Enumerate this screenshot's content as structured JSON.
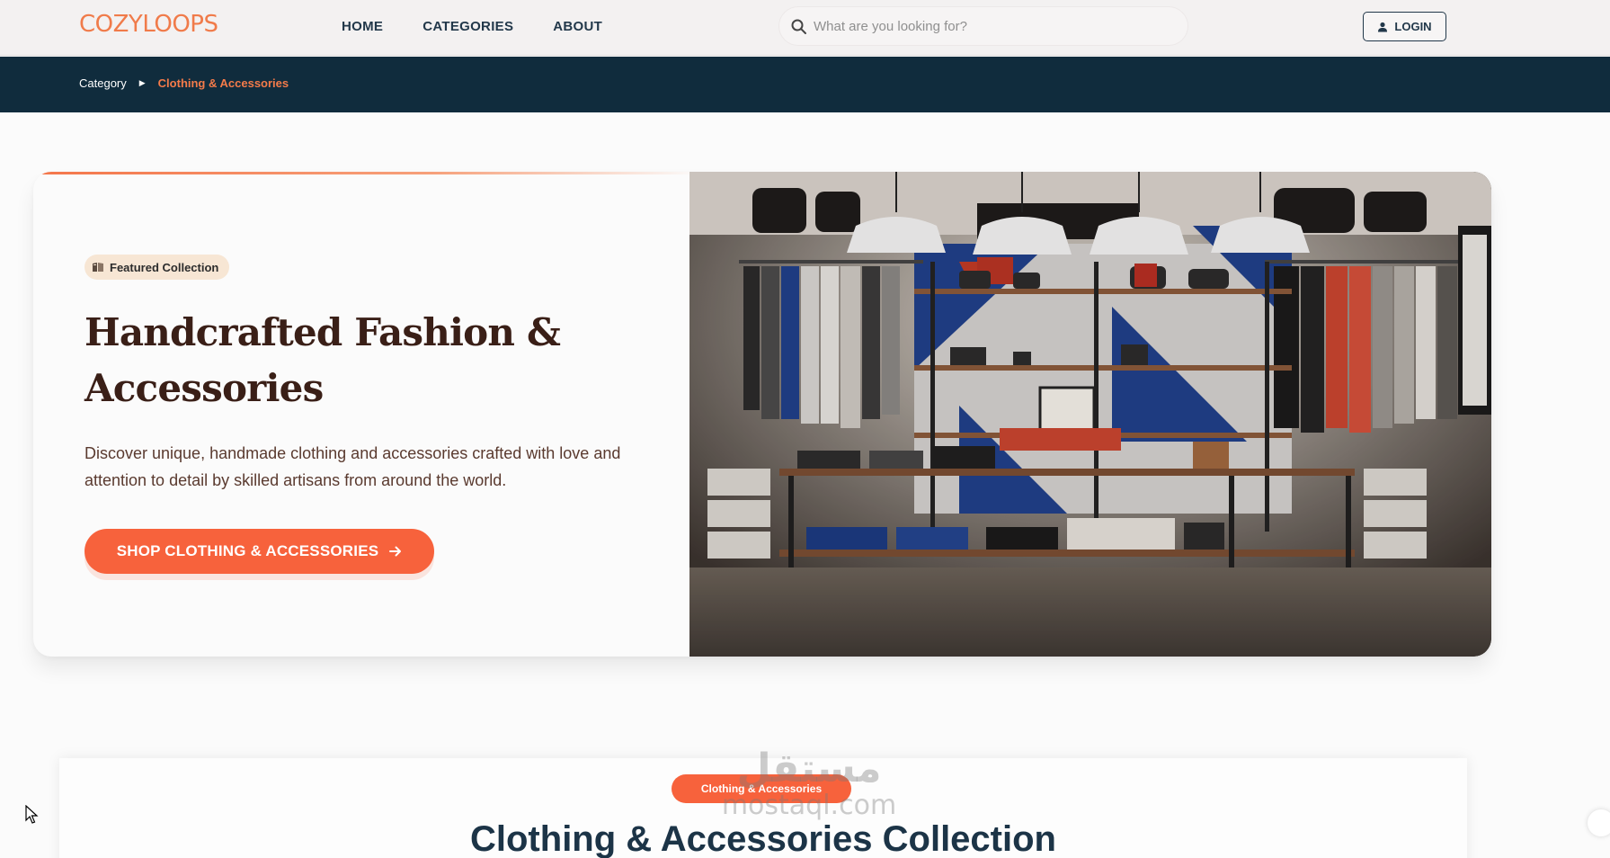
{
  "header": {
    "logo": "COZYLOOPS",
    "nav": [
      {
        "label": "HOME"
      },
      {
        "label": "CATEGORIES"
      },
      {
        "label": "ABOUT"
      }
    ],
    "search": {
      "placeholder": "What are you looking for?",
      "icon": "search-icon"
    },
    "login_label": "LOGIN",
    "login_icon": "user-icon"
  },
  "breadcrumb": {
    "home": "Category",
    "current": "Clothing & Accessories",
    "separator_icon": "caret-right-icon"
  },
  "hero": {
    "badge": "Featured Collection",
    "badge_icon": "book-icon",
    "title": "Handcrafted Fashion & Accessories",
    "description": "Discover unique, handmade clothing and accessories crafted with love and attention to detail by skilled artisans from around the world.",
    "cta_label": "SHOP CLOTHING & ACCESSORIES",
    "cta_icon": "arrow-right-icon",
    "image_alt": "clothing store interior",
    "accent_color": "#f7623c"
  },
  "section": {
    "pill": "Clothing & Accessories",
    "title": "Clothing & Accessories Collection"
  },
  "watermark": {
    "arabic": "مستقل",
    "latin": "mostaql.com"
  },
  "colors": {
    "navy": "#102c3d",
    "accent": "#f7623c",
    "title_brown": "#3a1f17"
  }
}
